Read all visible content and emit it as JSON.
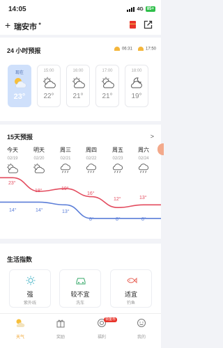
{
  "status": {
    "time": "14:05",
    "network": "4G",
    "battery": "85+"
  },
  "header": {
    "add_label": "+",
    "city": "瑞安市"
  },
  "hourly": {
    "title": "24 小时预报",
    "sunrise": "06:31",
    "sunset": "17:50",
    "items": [
      {
        "time": "现在",
        "temp": "23°",
        "icon": "partly-cloudy-sun-icon"
      },
      {
        "time": "15:00",
        "temp": "22°",
        "icon": "partly-cloudy-sun-icon"
      },
      {
        "time": "16:00",
        "temp": "21°",
        "icon": "partly-cloudy-sun-icon"
      },
      {
        "time": "17:00",
        "temp": "21°",
        "icon": "partly-cloudy-sun-icon"
      },
      {
        "time": "18:00",
        "temp": "19°",
        "icon": "partly-cloudy-moon-icon"
      }
    ]
  },
  "daily": {
    "title": "15天预报",
    "days": [
      {
        "weekday": "今天",
        "date": "02/19",
        "icon": "partly-cloudy-sun-icon",
        "high": "23°",
        "low": "14°"
      },
      {
        "weekday": "明天",
        "date": "02/20",
        "icon": "partly-cloudy-sun-icon",
        "high": "18°",
        "low": "14°"
      },
      {
        "weekday": "周三",
        "date": "02/21",
        "icon": "rain-icon",
        "high": "19°",
        "low": "13°"
      },
      {
        "weekday": "周四",
        "date": "02/22",
        "icon": "rain-icon",
        "high": "16°",
        "low": "8°"
      },
      {
        "weekday": "周五",
        "date": "02/23",
        "icon": "rain-icon",
        "high": "12°",
        "low": "8°"
      },
      {
        "weekday": "周六",
        "date": "02/24",
        "icon": "rain-icon",
        "high": "13°",
        "low": "8°"
      }
    ],
    "chart_data": {
      "type": "line",
      "categories": [
        "今天",
        "明天",
        "周三",
        "周四",
        "周五",
        "周六"
      ],
      "series": [
        {
          "values": [
            23,
            18,
            19,
            16,
            12,
            13
          ],
          "color": "#e34b5e"
        },
        {
          "values": [
            14,
            14,
            13,
            8,
            8,
            8
          ],
          "color": "#5b7ed8"
        }
      ]
    }
  },
  "life": {
    "title": "生活指数",
    "items": [
      {
        "value": "强",
        "label": "紫外线",
        "icon": "sun-icon"
      },
      {
        "value": "较不宜",
        "label": "洗车",
        "icon": "car-icon"
      },
      {
        "value": "适宜",
        "label": "钓鱼",
        "icon": "fish-icon"
      }
    ]
  },
  "tabs": [
    {
      "label": "天气",
      "icon": "weather-icon",
      "active": true
    },
    {
      "label": "奖励",
      "icon": "gift-icon",
      "active": false
    },
    {
      "label": "福利",
      "icon": "coin-icon",
      "active": false,
      "badge": "领金币"
    },
    {
      "label": "我的",
      "icon": "profile-icon",
      "active": false
    }
  ]
}
